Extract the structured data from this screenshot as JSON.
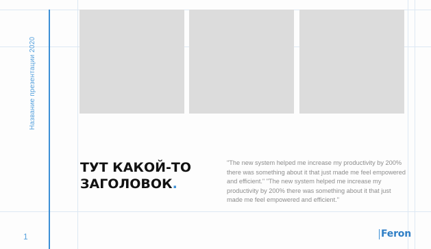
{
  "slide": {
    "side_title": "Название презентации  2020",
    "page_number": "1",
    "heading_line1": "ТУТ КАКОЙ-ТО",
    "heading_line2": "ЗАГОЛОВОК",
    "heading_dot": ".",
    "quote": "\"The new system helped me increase my productivity by 200% there was something about it that just made me feel empowered and efficient.\" \"The new system helped me increase my productivity by 200% there was something about it that just made me feel empowered and efficient.\"",
    "logo_text": "Feron"
  },
  "colors": {
    "accent": "#3b8fd6",
    "guide": "#dde8f3",
    "placeholder": "#dcdcdc",
    "heading": "#121212",
    "body_text": "#8c8c8c"
  }
}
